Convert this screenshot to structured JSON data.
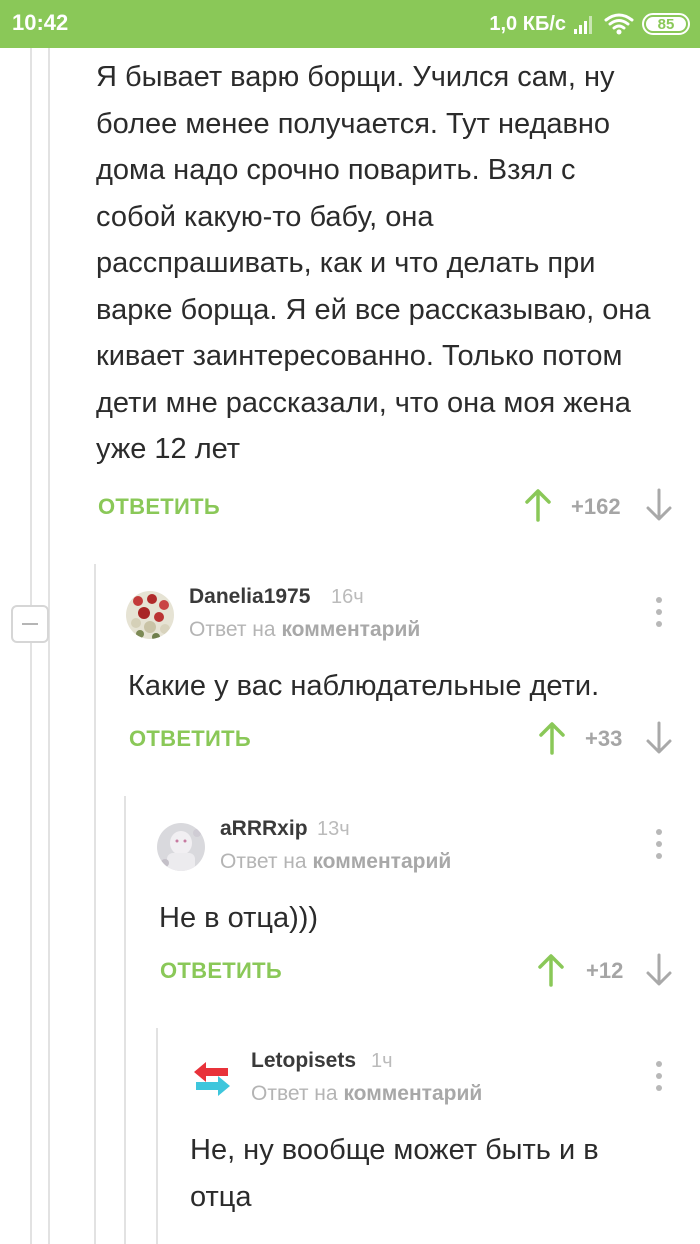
{
  "status_bar": {
    "time": "10:42",
    "speed": "1,0 КБ/с",
    "battery": "85",
    "battery_level": 0.85
  },
  "colors": {
    "accent": "#8ac858",
    "text": "#2b2b2b",
    "muted": "#b4b4b4"
  },
  "comments": [
    {
      "text": "Я бывает варю борщи. Учился сам, ну более менее получается. Тут недавно дома надо срочно поварить. Взял с собой какую-то бабу, она расспрашивать, как и что делать при варке борща. Я ей все рассказываю, она кивает заинтересованно. Только потом дети мне рассказали, что она моя жена уже 12 лет",
      "reply_label": "ОТВЕТИТЬ",
      "rating": "+162"
    },
    {
      "author": "Danelia1975",
      "time": "16ч",
      "reply_prefix": "Ответ на",
      "reply_target": "комментарий",
      "text": "Какие у вас наблюдательные дети.",
      "reply_label": "ОТВЕТИТЬ",
      "rating": "+33"
    },
    {
      "author": "aRRRxip",
      "time": "13ч",
      "reply_prefix": "Ответ на",
      "reply_target": "комментарий",
      "text": "Не в отца)))",
      "reply_label": "ОТВЕТИТЬ",
      "rating": "+12"
    },
    {
      "author": "Letopisets",
      "time": "1ч",
      "reply_prefix": "Ответ на",
      "reply_target": "комментарий",
      "text": "Не, ну вообще может быть и в отца"
    }
  ],
  "icons": {
    "upvote": "arrow-up-icon",
    "downvote": "arrow-down-icon",
    "menu": "more-vertical-icon",
    "collapse": "minus-icon"
  }
}
